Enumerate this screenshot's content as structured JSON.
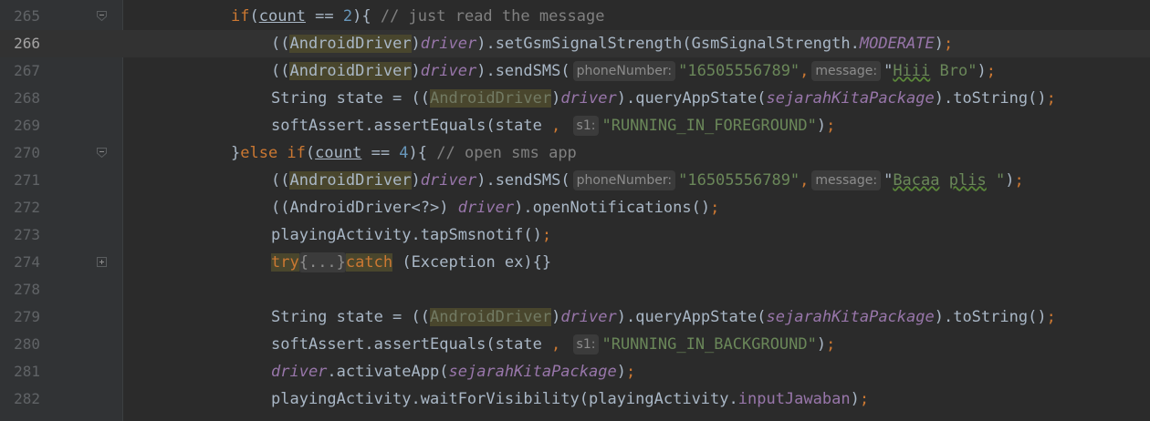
{
  "editor": {
    "lines": [
      {
        "num": "265",
        "parts": [
          {
            "t": "if",
            "c": "kw"
          },
          {
            "t": "("
          },
          {
            "t": "count",
            "c": "ul"
          },
          {
            "t": " == "
          },
          {
            "t": "2",
            "c": "num"
          },
          {
            "t": "){ "
          },
          {
            "t": "// just read the message",
            "c": "cm"
          }
        ]
      },
      {
        "num": "266",
        "current": true,
        "parts": [
          {
            "t": "(("
          },
          {
            "t": "AndroidDriver",
            "c": "hl"
          },
          {
            "t": ")"
          },
          {
            "t": "driver",
            "c": "field it"
          },
          {
            "t": ").setGsmSignalStrength(GsmSignalStrength."
          },
          {
            "t": "MODERATE",
            "c": "field it"
          },
          {
            "t": ")"
          },
          {
            "t": ";",
            "c": "kw"
          }
        ]
      },
      {
        "num": "267",
        "parts": [
          {
            "t": "(("
          },
          {
            "t": "AndroidDriver",
            "c": "hl"
          },
          {
            "t": ")"
          },
          {
            "t": "driver",
            "c": "field it"
          },
          {
            "t": ").sendSMS("
          },
          {
            "t": "phoneNumber:",
            "c": "hint"
          },
          {
            "t": "\"16505556789\"",
            "c": "str"
          },
          {
            "t": ",",
            "c": "kw"
          },
          {
            "t": "message:",
            "c": "hint"
          },
          {
            "t": "\""
          },
          {
            "t": "Hiii",
            "c": "str wavy"
          },
          {
            "t": " Bro\"",
            "c": "str"
          },
          {
            "t": ")"
          },
          {
            "t": ";",
            "c": "kw"
          }
        ]
      },
      {
        "num": "268",
        "parts": [
          {
            "t": "String state = (("
          },
          {
            "t": "AndroidDriver",
            "c": "hlgray"
          },
          {
            "t": ")"
          },
          {
            "t": "driver",
            "c": "field it"
          },
          {
            "t": ").queryAppState("
          },
          {
            "t": "sejarahKitaPackage",
            "c": "field it"
          },
          {
            "t": ").toString()"
          },
          {
            "t": ";",
            "c": "kw"
          }
        ]
      },
      {
        "num": "269",
        "parts": [
          {
            "t": "softAssert.assertEquals(state "
          },
          {
            "t": ",",
            "c": "kw"
          },
          {
            "t": " "
          },
          {
            "t": "s1:",
            "c": "hint"
          },
          {
            "t": "\"RUNNING_IN_FOREGROUND\"",
            "c": "str"
          },
          {
            "t": ")"
          },
          {
            "t": ";",
            "c": "kw"
          }
        ]
      },
      {
        "num": "270",
        "parts": [
          {
            "t": "}"
          },
          {
            "t": "else if",
            "c": "kw"
          },
          {
            "t": "("
          },
          {
            "t": "count",
            "c": "ul"
          },
          {
            "t": " == "
          },
          {
            "t": "4",
            "c": "num"
          },
          {
            "t": "){ "
          },
          {
            "t": "// open sms app",
            "c": "cm"
          }
        ]
      },
      {
        "num": "271",
        "parts": [
          {
            "t": "(("
          },
          {
            "t": "AndroidDriver",
            "c": "hl"
          },
          {
            "t": ")"
          },
          {
            "t": "driver",
            "c": "field it"
          },
          {
            "t": ").sendSMS("
          },
          {
            "t": "phoneNumber:",
            "c": "hint"
          },
          {
            "t": "\"16505556789\"",
            "c": "str"
          },
          {
            "t": ",",
            "c": "kw"
          },
          {
            "t": "message:",
            "c": "hint"
          },
          {
            "t": "\""
          },
          {
            "t": "Bacaa",
            "c": "str wavy"
          },
          {
            "t": " ",
            "c": "str"
          },
          {
            "t": "plis",
            "c": "str wavy"
          },
          {
            "t": " \"",
            "c": "str"
          },
          {
            "t": ")"
          },
          {
            "t": ";",
            "c": "kw"
          }
        ]
      },
      {
        "num": "272",
        "parts": [
          {
            "t": "((AndroidDriver<?>) "
          },
          {
            "t": "driver",
            "c": "field it"
          },
          {
            "t": ").openNotifications()"
          },
          {
            "t": ";",
            "c": "kw"
          }
        ]
      },
      {
        "num": "273",
        "parts": [
          {
            "t": "playingActivity.tapSmsnotif()"
          },
          {
            "t": ";",
            "c": "kw"
          }
        ]
      },
      {
        "num": "274",
        "parts": [
          {
            "t": "try",
            "c": "kw hl"
          },
          {
            "t": "{...}",
            "c": "folded"
          },
          {
            "t": "catch",
            "c": "kw hl"
          },
          {
            "t": " (Exception ex){}"
          }
        ]
      },
      {
        "num": "278",
        "parts": []
      },
      {
        "num": "279",
        "parts": [
          {
            "t": "String state = (("
          },
          {
            "t": "AndroidDriver",
            "c": "hlgray"
          },
          {
            "t": ")"
          },
          {
            "t": "driver",
            "c": "field it"
          },
          {
            "t": ").queryAppState("
          },
          {
            "t": "sejarahKitaPackage",
            "c": "field it"
          },
          {
            "t": ").toString()"
          },
          {
            "t": ";",
            "c": "kw"
          }
        ]
      },
      {
        "num": "280",
        "parts": [
          {
            "t": "softAssert.assertEquals(state "
          },
          {
            "t": ",",
            "c": "kw"
          },
          {
            "t": " "
          },
          {
            "t": "s1:",
            "c": "hint"
          },
          {
            "t": "\"RUNNING_IN_BACKGROUND\"",
            "c": "str"
          },
          {
            "t": ")"
          },
          {
            "t": ";",
            "c": "kw"
          }
        ]
      },
      {
        "num": "281",
        "parts": [
          {
            "t": "driver",
            "c": "field it"
          },
          {
            "t": ".activateApp("
          },
          {
            "t": "sejarahKitaPackage",
            "c": "field it"
          },
          {
            "t": ")"
          },
          {
            "t": ";",
            "c": "kw"
          }
        ]
      },
      {
        "num": "282",
        "parts": [
          {
            "t": "playingActivity.waitForVisibility(playingActivity."
          },
          {
            "t": "inputJawaban",
            "c": "field"
          },
          {
            "t": ")"
          },
          {
            "t": ";",
            "c": "kw"
          }
        ]
      }
    ]
  },
  "colors": {
    "background": "#2b2b2b",
    "gutter": "#313335",
    "keyword": "#cc7832",
    "string": "#6a8759",
    "comment": "#808080",
    "number": "#6897bb",
    "field": "#9876aa"
  }
}
